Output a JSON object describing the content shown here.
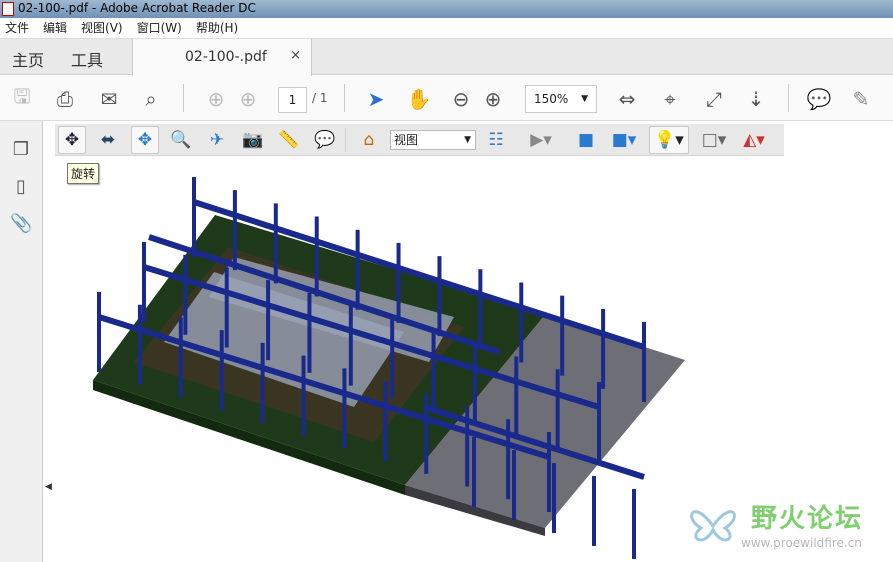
{
  "window": {
    "title": "02-100-.pdf - Adobe Acrobat Reader DC"
  },
  "menu": [
    "文件",
    "编辑",
    "视图(V)",
    "窗口(W)",
    "帮助(H)"
  ],
  "tabs": {
    "home": "主页",
    "tools": "工具",
    "document": "02-100-.pdf",
    "close": "×"
  },
  "toolbar": {
    "page_current": "1",
    "page_total": "/ 1",
    "zoom": "150%"
  },
  "toolbar3d": {
    "view_select": "视图",
    "tooltip": "旋转"
  },
  "watermark": {
    "name": "野火论坛",
    "url": "www.proewildfire.cn"
  },
  "colors": {
    "steel": "#1a2a8c",
    "ground": "#1f3a1a",
    "slab": "#6e6e76",
    "accent": "#2c6fce"
  }
}
